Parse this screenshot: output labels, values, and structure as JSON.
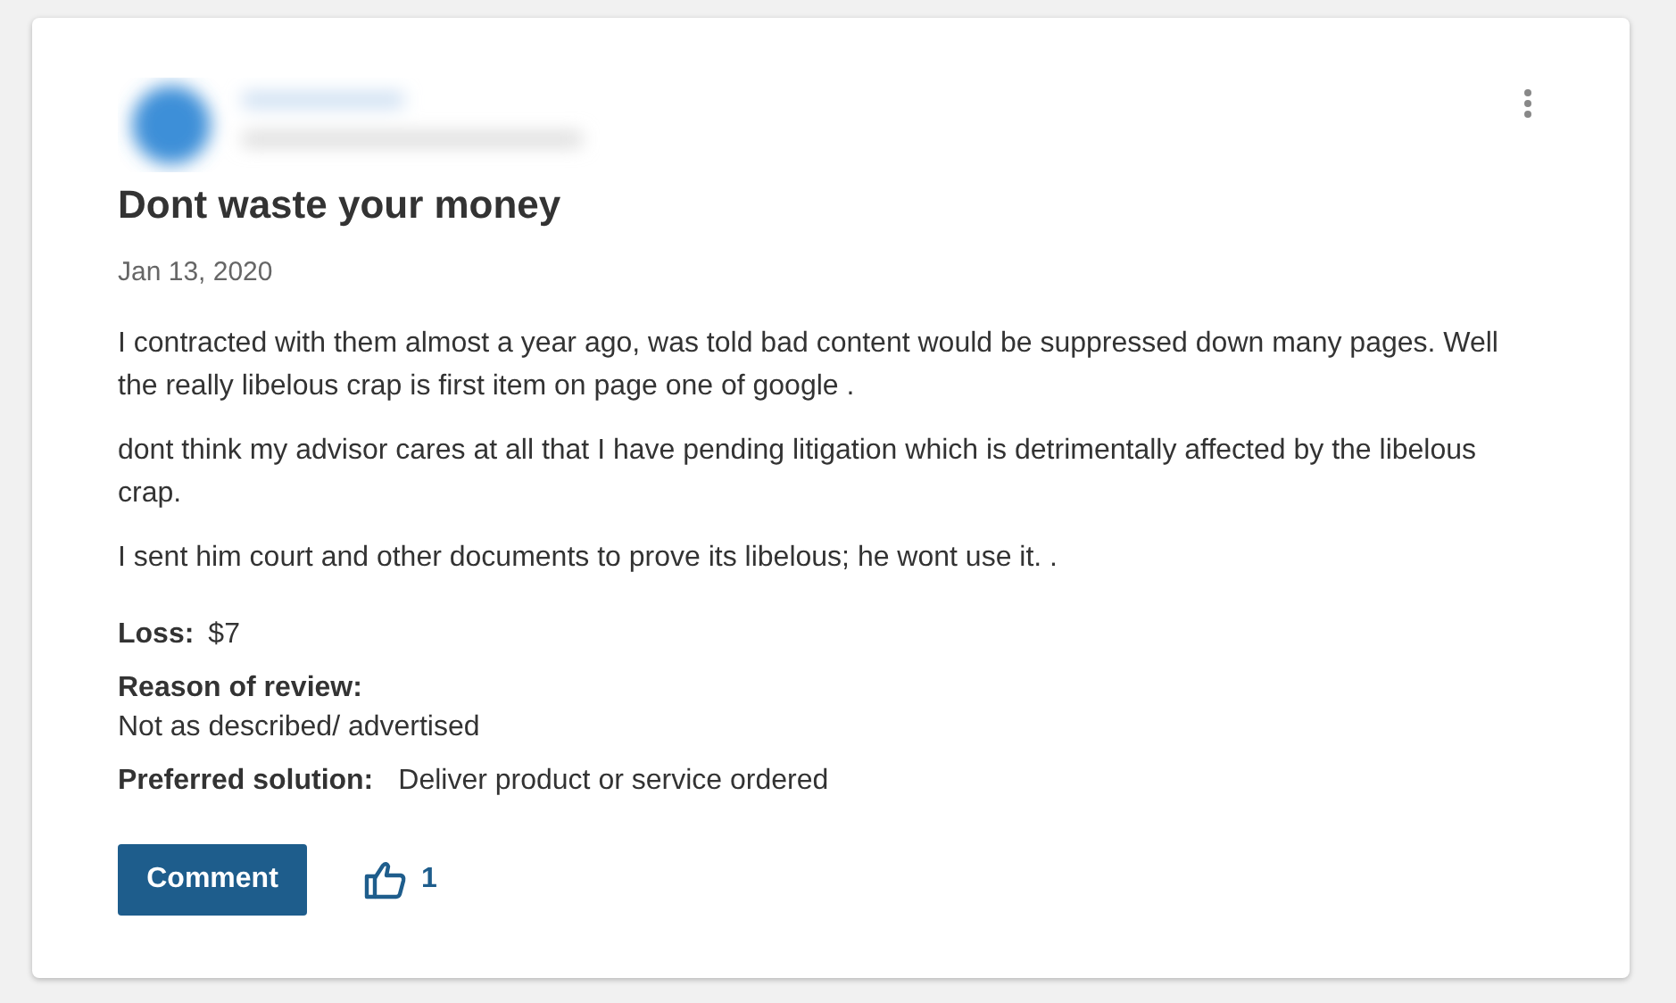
{
  "review": {
    "title": "Dont waste your money",
    "date": "Jan 13, 2020",
    "paragraphs": [
      "I contracted with them almost a year ago, was told bad content would be suppressed down many pages. Well the really libelous crap is first item on page one of google .",
      "dont think my advisor cares at all that I have pending litigation which is detrimentally affected by the libelous crap.",
      "I sent him court and other documents to prove its libelous; he wont use it. ."
    ],
    "loss": {
      "label": "Loss:",
      "value": "$7"
    },
    "reason": {
      "label": "Reason of review:",
      "value": "Not as described/ advertised"
    },
    "solution": {
      "label": "Preferred solution:",
      "value": "Deliver product or service ordered"
    },
    "comment_button": "Comment",
    "likes": "1"
  }
}
